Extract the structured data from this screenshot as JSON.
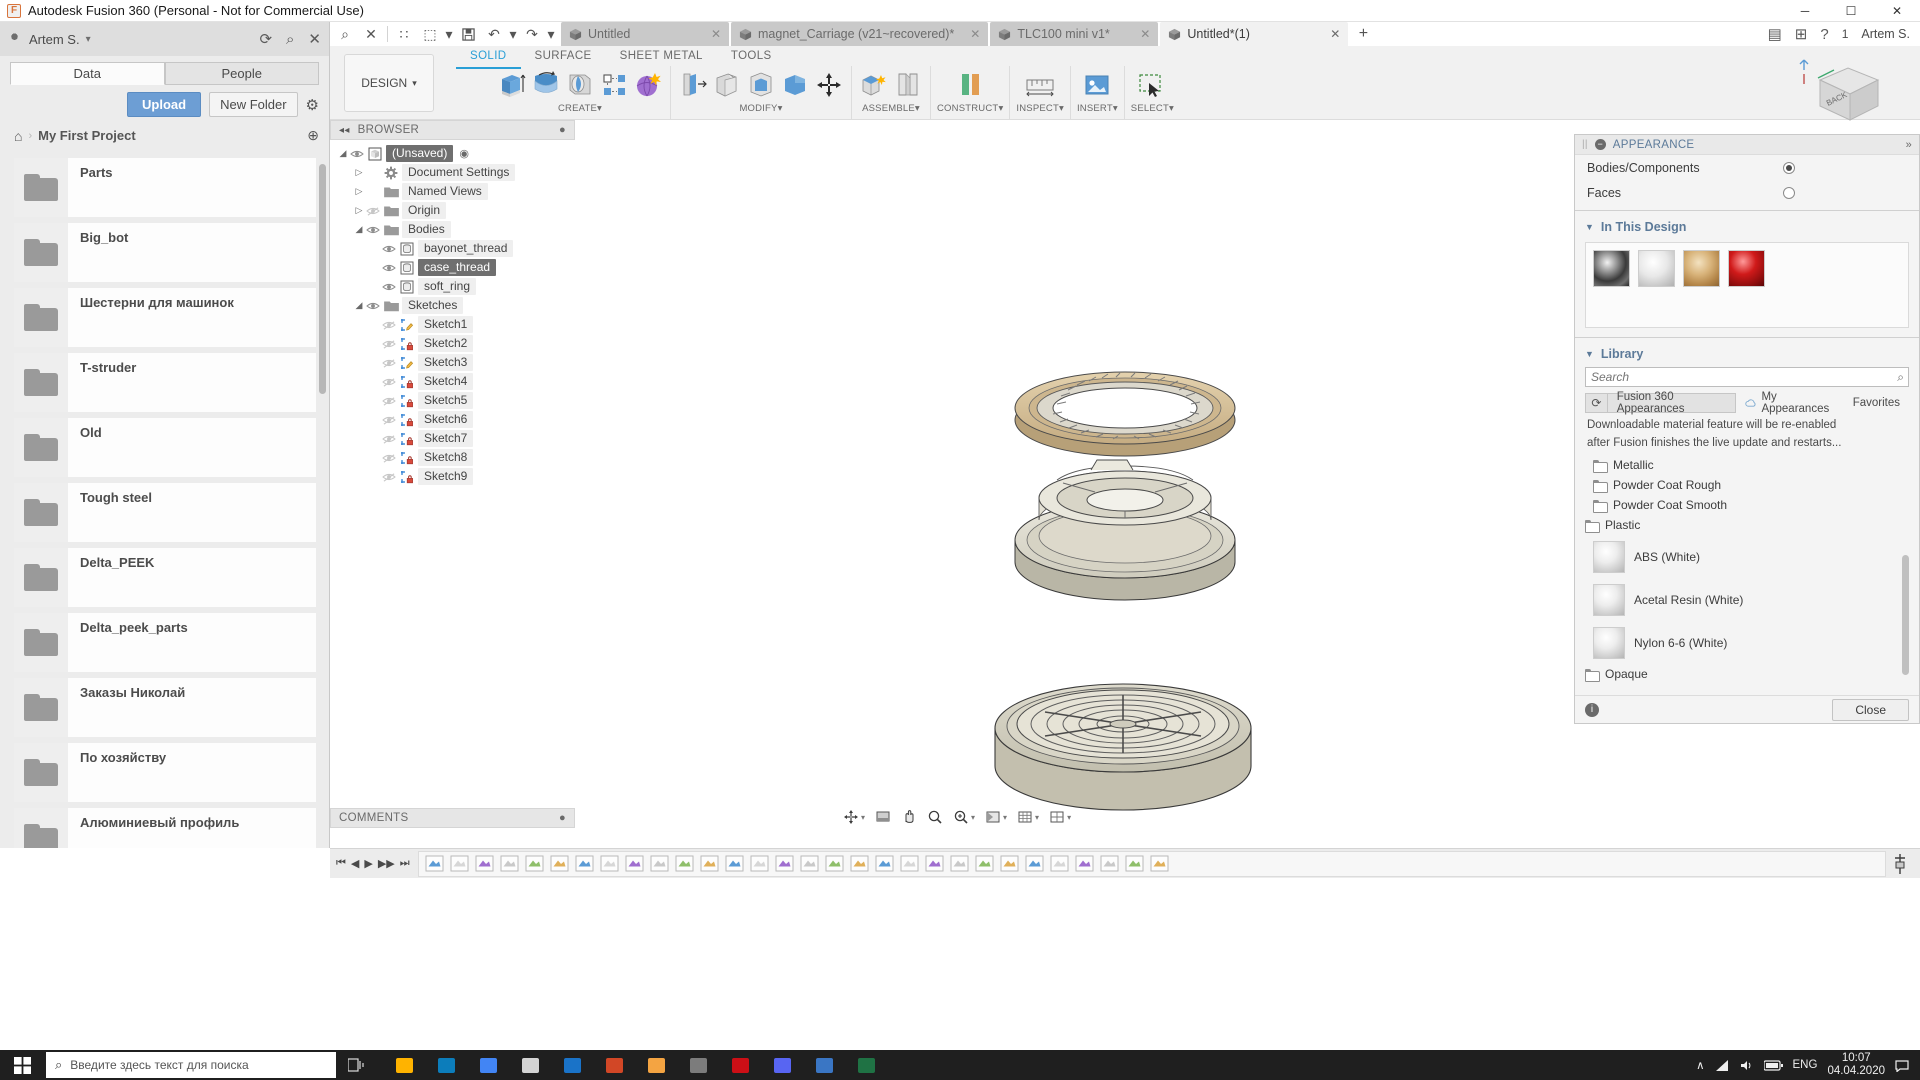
{
  "window": {
    "title": "Autodesk Fusion 360 (Personal - Not for Commercial Use)",
    "app_icon": "F",
    "minimize": "─",
    "maximize": "☐",
    "close": "✕"
  },
  "data_panel": {
    "user_name": "Artem S.",
    "caret": "▾",
    "refresh_icon": "⟳",
    "search_icon": "⌕",
    "close_icon": "✕",
    "tabs": [
      {
        "label": "Data",
        "active": true
      },
      {
        "label": "People",
        "active": false
      }
    ],
    "upload_label": "Upload",
    "new_folder_label": "New Folder",
    "settings_icon": "⚙",
    "breadcrumb": {
      "home_icon": "⌂",
      "separator": "›",
      "project": "My First Project",
      "globe_icon": "⊕"
    },
    "folders": [
      {
        "name": "Parts"
      },
      {
        "name": "Big_bot"
      },
      {
        "name": "Шестерни для машинок"
      },
      {
        "name": "T-struder"
      },
      {
        "name": "Old"
      },
      {
        "name": "Tough steel"
      },
      {
        "name": "Delta_PEEK"
      },
      {
        "name": "Delta_peek_parts"
      },
      {
        "name": "Заказы Николай"
      },
      {
        "name": "По хозяйству"
      },
      {
        "name": "Алюминиевый профиль"
      },
      {
        "name": ""
      }
    ]
  },
  "quick_access": {
    "grid_icon": "∷",
    "new_icon": "⬚",
    "save_icon": "💾",
    "undo_icon": "↶",
    "redo_icon": "↷",
    "caret": "▾",
    "document_tabs": [
      {
        "label": "Untitled",
        "active": false,
        "close": "✕"
      },
      {
        "label": "magnet_Carriage (v21~recovered)*",
        "active": false,
        "close": "✕"
      },
      {
        "label": "TLC100 mini v1*",
        "active": false,
        "close": "✕"
      },
      {
        "label": "Untitled*(1)",
        "active": true,
        "close": "✕"
      }
    ],
    "add_tab": "+",
    "right_icons": {
      "jobs_icon": "▤",
      "extensions_icon": "⊞",
      "help_icon": "?",
      "notifications_count": "1",
      "user_name": "Artem S."
    }
  },
  "ribbon": {
    "workspace_label": "DESIGN",
    "workspace_caret": "▾",
    "tabs": [
      {
        "label": "SOLID",
        "active": true
      },
      {
        "label": "SURFACE",
        "active": false
      },
      {
        "label": "SHEET METAL",
        "active": false
      },
      {
        "label": "TOOLS",
        "active": false
      }
    ],
    "panels": [
      {
        "label": "CREATE",
        "caret": "▾",
        "tools": [
          "extrude-tool",
          "revolve-tool",
          "sweep-tool",
          "pattern-tool",
          "form-tool"
        ]
      },
      {
        "label": "MODIFY",
        "caret": "▾",
        "tools": [
          "press-pull-tool",
          "fillet-tool",
          "shell-tool",
          "combine-tool",
          "move-copy-tool"
        ]
      },
      {
        "label": "ASSEMBLE",
        "caret": "▾",
        "tools": [
          "new-component-tool",
          "joint-tool"
        ]
      },
      {
        "label": "CONSTRUCT",
        "caret": "▾",
        "tools": [
          "offset-plane-tool"
        ]
      },
      {
        "label": "INSPECT",
        "caret": "▾",
        "tools": [
          "measure-tool"
        ]
      },
      {
        "label": "INSERT",
        "caret": "▾",
        "tools": [
          "insert-mcmaster-tool"
        ]
      },
      {
        "label": "SELECT",
        "caret": "▾",
        "tools": [
          "select-window-tool"
        ]
      }
    ]
  },
  "browser": {
    "title": "BROWSER",
    "collapse_icon": "◂◂",
    "menu_icon": "●",
    "nodes": [
      {
        "label": "(Unsaved)",
        "indent": 0,
        "expander": "◢",
        "eye": "visible",
        "icon": "component-icon",
        "selected": true,
        "trailing": "◉"
      },
      {
        "label": "Document Settings",
        "indent": 1,
        "expander": "▷",
        "eye": "none",
        "icon": "gear-icon",
        "selected": false
      },
      {
        "label": "Named Views",
        "indent": 1,
        "expander": "▷",
        "eye": "none",
        "icon": "folder-icon",
        "selected": false
      },
      {
        "label": "Origin",
        "indent": 1,
        "expander": "▷",
        "eye": "hidden",
        "icon": "folder-icon",
        "selected": false
      },
      {
        "label": "Bodies",
        "indent": 1,
        "expander": "◢",
        "eye": "visible",
        "icon": "folder-icon",
        "selected": false
      },
      {
        "label": "bayonet_thread",
        "indent": 2,
        "expander": "",
        "eye": "visible",
        "icon": "body-icon",
        "selected": false
      },
      {
        "label": "case_thread",
        "indent": 2,
        "expander": "",
        "eye": "visible",
        "icon": "body-icon",
        "selected": true
      },
      {
        "label": "soft_ring",
        "indent": 2,
        "expander": "",
        "eye": "visible",
        "icon": "body-icon",
        "selected": false
      },
      {
        "label": "Sketches",
        "indent": 1,
        "expander": "◢",
        "eye": "visible",
        "icon": "folder-icon",
        "selected": false
      },
      {
        "label": "Sketch1",
        "indent": 2,
        "expander": "",
        "eye": "hidden",
        "icon": "sketch-icon",
        "selected": false
      },
      {
        "label": "Sketch2",
        "indent": 2,
        "expander": "",
        "eye": "hidden",
        "icon": "sketch-locked-icon",
        "selected": false
      },
      {
        "label": "Sketch3",
        "indent": 2,
        "expander": "",
        "eye": "hidden",
        "icon": "sketch-icon",
        "selected": false
      },
      {
        "label": "Sketch4",
        "indent": 2,
        "expander": "",
        "eye": "hidden",
        "icon": "sketch-locked-icon",
        "selected": false
      },
      {
        "label": "Sketch5",
        "indent": 2,
        "expander": "",
        "eye": "hidden",
        "icon": "sketch-locked-icon",
        "selected": false
      },
      {
        "label": "Sketch6",
        "indent": 2,
        "expander": "",
        "eye": "hidden",
        "icon": "sketch-locked-icon",
        "selected": false
      },
      {
        "label": "Sketch7",
        "indent": 2,
        "expander": "",
        "eye": "hidden",
        "icon": "sketch-locked-icon",
        "selected": false
      },
      {
        "label": "Sketch8",
        "indent": 2,
        "expander": "",
        "eye": "hidden",
        "icon": "sketch-locked-icon",
        "selected": false
      },
      {
        "label": "Sketch9",
        "indent": 2,
        "expander": "",
        "eye": "hidden",
        "icon": "sketch-locked-icon",
        "selected": false
      }
    ]
  },
  "comments": {
    "title": "COMMENTS",
    "menu_icon": "●"
  },
  "viewcube": {
    "face_label": "BACK"
  },
  "appearance": {
    "title": "APPEARANCE",
    "collapse_dot": "−",
    "expand_icon": "»",
    "apply_to": [
      {
        "label": "Bodies/Components",
        "selected": true
      },
      {
        "label": "Faces",
        "selected": false
      }
    ],
    "in_this_design": {
      "title": "In This Design",
      "caret": "▼",
      "swatches": [
        "chrome-swatch",
        "white-plastic-swatch",
        "brass-swatch",
        "red-glossy-swatch"
      ]
    },
    "library": {
      "title": "Library",
      "caret": "▼",
      "search_placeholder": "Search",
      "search_value": "",
      "search_icon": "⌕",
      "refresh_icon": "⟳",
      "tabs": [
        {
          "label": "Fusion 360 Appearances",
          "active": true
        },
        {
          "label": "My Appearances",
          "active": false
        },
        {
          "label": "Favorites",
          "active": false
        }
      ],
      "notes": [
        "Downloadable material feature will be re-enabled",
        "after Fusion finishes the live update and restarts..."
      ],
      "items": [
        {
          "label": "Metallic",
          "type": "folder",
          "indent": 1
        },
        {
          "label": "Powder Coat Rough",
          "type": "folder",
          "indent": 1
        },
        {
          "label": "Powder Coat Smooth",
          "type": "folder",
          "indent": 1
        },
        {
          "label": "Plastic",
          "type": "folder",
          "indent": 0
        },
        {
          "label": "ABS (White)",
          "type": "material",
          "indent": 1
        },
        {
          "label": "Acetal Resin (White)",
          "type": "material",
          "indent": 1
        },
        {
          "label": "Nylon 6-6 (White)",
          "type": "material",
          "indent": 1
        },
        {
          "label": "Opaque",
          "type": "folder",
          "indent": 0
        }
      ]
    },
    "info_icon": "i",
    "close_label": "Close"
  },
  "navbar": {
    "items": [
      {
        "name": "orbit-tool",
        "icon": "⊕",
        "caret": "▾"
      },
      {
        "name": "pan-tool",
        "icon": "✋",
        "caret": ""
      },
      {
        "name": "zoom-tool",
        "icon": "⌕",
        "caret": ""
      },
      {
        "name": "zoom-window-tool",
        "icon": "⌕",
        "caret": "▾"
      },
      {
        "name": "display-settings",
        "icon": "◱",
        "caret": "▾"
      },
      {
        "name": "grid-snaps",
        "icon": "⌗",
        "caret": "▾"
      },
      {
        "name": "viewports",
        "icon": "⊞",
        "caret": "▾"
      }
    ],
    "fit_icon": "⬚"
  },
  "timeline": {
    "controls": [
      "⏮",
      "◀",
      "▶",
      "▶▶",
      "⏭"
    ],
    "feature_count": 30,
    "end_marker": "⬚"
  },
  "taskbar": {
    "start_icon": "⊞",
    "search_placeholder": "Введите здесь текст для поиска",
    "search_icon": "⌕",
    "task_view_icon": "◫",
    "apps": [
      {
        "name": "file-explorer-icon",
        "color": "#ffb300"
      },
      {
        "name": "edge-icon",
        "color": "#0c7dbb"
      },
      {
        "name": "chrome-icon",
        "color": "#4285f4"
      },
      {
        "name": "store-icon",
        "color": "#d4d4d4"
      },
      {
        "name": "mail-icon",
        "color": "#1a73c8"
      },
      {
        "name": "powerpoint-icon",
        "color": "#d24726"
      },
      {
        "name": "fusion360-icon",
        "color": "#f4a442"
      },
      {
        "name": "slicer-icon",
        "color": "#7c7c7c"
      },
      {
        "name": "opera-icon",
        "color": "#cc0f16"
      },
      {
        "name": "discord-icon",
        "color": "#5865f2"
      },
      {
        "name": "app-icon",
        "color": "#3a76c4"
      },
      {
        "name": "excel-icon",
        "color": "#1f7244"
      }
    ],
    "tray": {
      "chevron": "∧",
      "network_icon": "◢",
      "volume_icon": "🔊",
      "battery_icon": "▭",
      "language": "ENG",
      "time": "10:07",
      "date": "04.04.2020",
      "notification_icon": "□"
    }
  }
}
